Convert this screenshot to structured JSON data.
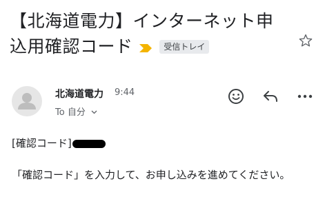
{
  "email": {
    "subject": "【北海道電力】インターネット申込用確認コード",
    "label": "受信トレイ",
    "important_marker_color": "#f4b400",
    "sender": "北海道電力",
    "time": "9:44",
    "recipient_prefix": "To",
    "recipient": "自分",
    "body_code_label": "[確認コード]",
    "body_paragraph": "「確認コード」を入力して、お申し込みを進めてください。"
  },
  "icons": {
    "star": "star-outline-icon",
    "emoji": "add-emoji-icon",
    "reply": "reply-arrow-icon",
    "more": "more-horizontal-icon",
    "chevron": "chevron-down-icon",
    "avatar": "person-silhouette-icon"
  }
}
